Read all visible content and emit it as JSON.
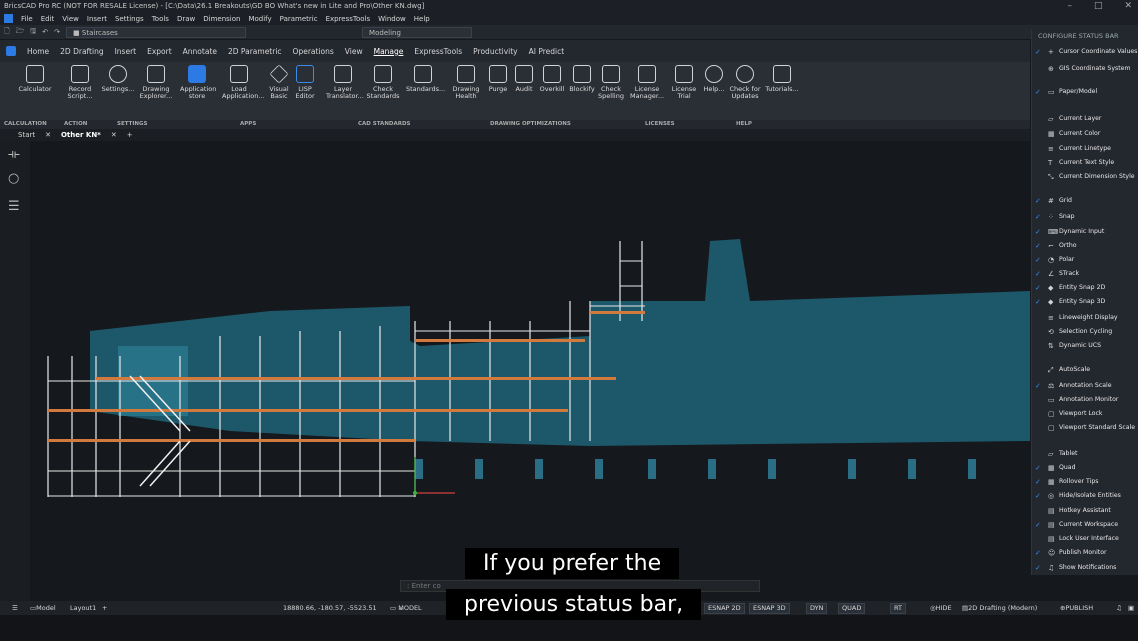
{
  "window": {
    "title": "BricsCAD Pro RC (NOT FOR RESALE License) - [C:\\Data\\26.1 Breakouts\\GD BO What's new in Lite and Pro\\Other KN.dwg]"
  },
  "menu": [
    "File",
    "Edit",
    "View",
    "Insert",
    "Settings",
    "Tools",
    "Draw",
    "Dimension",
    "Modify",
    "Parametric",
    "ExpressTools",
    "Window",
    "Help"
  ],
  "qat": {
    "layer": "Staircases",
    "workspace": "Modeling"
  },
  "tabs": [
    "Home",
    "2D Drafting",
    "Insert",
    "Export",
    "Annotate",
    "2D Parametric",
    "Operations",
    "View",
    "Manage",
    "ExpressTools",
    "Productivity",
    "AI Predict"
  ],
  "ribbon": {
    "buttons": [
      "Calculator",
      "Record Script...",
      "Settings...",
      "Drawing Explorer...",
      "Application store",
      "Load Application...",
      "Visual Basic",
      "LISP Editor",
      "Layer Translator...",
      "Check Standards",
      "Standards...",
      "Drawing Health",
      "Purge",
      "Audit",
      "Overkill",
      "Blockify",
      "Check Spelling",
      "License Manager...",
      "License Trial",
      "Help...",
      "Check for Updates",
      "Tutorials..."
    ],
    "groups": [
      "CALCULATION",
      "ACTION",
      "SETTINGS",
      "APPS",
      "CAD STANDARDS",
      "DRAWING OPTIMIZATIONS",
      "LICENSES",
      "HELP"
    ]
  },
  "doc_tabs": [
    "Start",
    "Other KN*"
  ],
  "panel": {
    "header": "CONFIGURE STATUS BAR",
    "items": [
      {
        "label": "Cursor Coordinate Values",
        "checked": true
      },
      {
        "label": "GIS Coordinate System",
        "checked": false
      },
      {
        "label": "Paper/Model",
        "checked": true
      },
      {
        "label": "Current Layer",
        "checked": false
      },
      {
        "label": "Current Color",
        "checked": false
      },
      {
        "label": "Current Linetype",
        "checked": false
      },
      {
        "label": "Current Text Style",
        "checked": false
      },
      {
        "label": "Current Dimension Style",
        "checked": false
      },
      {
        "label": "Grid",
        "checked": true
      },
      {
        "label": "Snap",
        "checked": true
      },
      {
        "label": "Dynamic Input",
        "checked": true
      },
      {
        "label": "Ortho",
        "checked": true
      },
      {
        "label": "Polar",
        "checked": true
      },
      {
        "label": "STrack",
        "checked": true
      },
      {
        "label": "Entity Snap 2D",
        "checked": true
      },
      {
        "label": "Entity Snap 3D",
        "checked": true
      },
      {
        "label": "Lineweight Display",
        "checked": false
      },
      {
        "label": "Selection Cycling",
        "checked": false
      },
      {
        "label": "Dynamic UCS",
        "checked": false
      },
      {
        "label": "AutoScale",
        "checked": false
      },
      {
        "label": "Annotation Scale",
        "checked": true
      },
      {
        "label": "Annotation Monitor",
        "checked": false
      },
      {
        "label": "Viewport Lock",
        "checked": false
      },
      {
        "label": "Viewport Standard Scale",
        "checked": false
      },
      {
        "label": "Tablet",
        "checked": false
      },
      {
        "label": "Quad",
        "checked": true
      },
      {
        "label": "Rollover Tips",
        "checked": true
      },
      {
        "label": "Hide/Isolate Entities",
        "checked": true
      },
      {
        "label": "Hotkey Assistant",
        "checked": false
      },
      {
        "label": "Current Workspace",
        "checked": true
      },
      {
        "label": "Lock User Interface",
        "checked": false
      },
      {
        "label": "Publish Monitor",
        "checked": true
      },
      {
        "label": "Show Notifications",
        "checked": true
      }
    ]
  },
  "command": {
    "placeholder": ": Enter co"
  },
  "status": {
    "model_tab": "Model",
    "layout_tab": "Layout1",
    "coords": "18880.66, -180.57, -5523.51",
    "model_btn": "MODEL",
    "esnap2d": "ESNAP 2D",
    "esnap3d": "ESNAP 3D",
    "dyn": "DYN",
    "quad": "QUAD",
    "rt": "RT",
    "hide": "HIDE",
    "workspace": "2D Drafting (Modern)",
    "publish": "PUBLISH"
  },
  "caption": {
    "line1": "If you prefer the",
    "line2": "previous status bar,"
  }
}
